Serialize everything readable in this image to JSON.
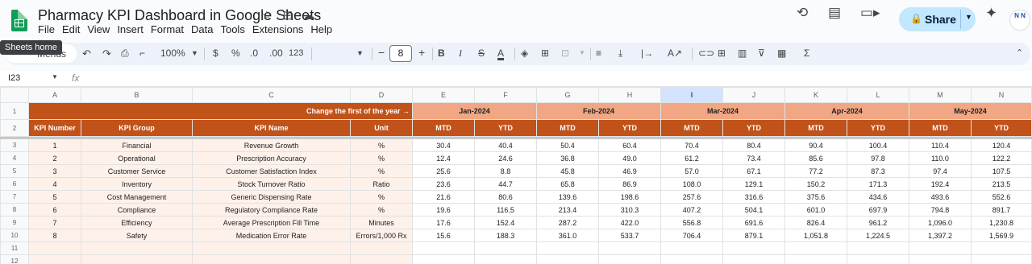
{
  "doc": {
    "title": "Pharmacy KPI Dashboard in Google Sheets"
  },
  "menu": [
    "File",
    "Edit",
    "View",
    "Insert",
    "Format",
    "Data",
    "Tools",
    "Extensions",
    "Help"
  ],
  "tooltip": "Sheets home",
  "share": {
    "label": "Share"
  },
  "avatar": {
    "text": "N N"
  },
  "toolbar": {
    "menus_label": "Menus",
    "zoom": "100%",
    "currency": "$",
    "percent": "%",
    "dec_decrease": ".0",
    "dec_increase": ".00",
    "number_format": "123",
    "font_size": "8",
    "bold": "B",
    "italic": "I",
    "text_color": "A",
    "sigma": "Σ"
  },
  "namebox": {
    "cell": "I23"
  },
  "formula": {
    "fx": "fx"
  },
  "columns": [
    "A",
    "B",
    "C",
    "D",
    "E",
    "F",
    "G",
    "H",
    "I",
    "J",
    "K",
    "L",
    "M",
    "N"
  ],
  "selected_column": "I",
  "rows": [
    "1",
    "2",
    "3",
    "4",
    "5",
    "6",
    "7",
    "8",
    "9",
    "10",
    "11",
    "12"
  ],
  "sheet": {
    "change_label": "Change the first of the year →",
    "months": [
      "Jan-2024",
      "Feb-2024",
      "Mar-2024",
      "Apr-2024",
      "May-2024"
    ],
    "headers": {
      "kpi_number": "KPI Number",
      "kpi_group": "KPI Group",
      "kpi_name": "KPI Name",
      "unit": "Unit",
      "mtd": "MTD",
      "ytd": "YTD"
    },
    "data": [
      {
        "num": "1",
        "group": "Financial",
        "name": "Revenue Growth",
        "unit": "%",
        "vals": [
          "30.4",
          "40.4",
          "50.4",
          "60.4",
          "70.4",
          "80.4",
          "90.4",
          "100.4",
          "110.4",
          "120.4"
        ]
      },
      {
        "num": "2",
        "group": "Operational",
        "name": "Prescription Accuracy",
        "unit": "%",
        "vals": [
          "12.4",
          "24.6",
          "36.8",
          "49.0",
          "61.2",
          "73.4",
          "85.6",
          "97.8",
          "110.0",
          "122.2"
        ]
      },
      {
        "num": "3",
        "group": "Customer Service",
        "name": "Customer Satisfaction Index",
        "unit": "%",
        "vals": [
          "25.6",
          "8.8",
          "45.8",
          "46.9",
          "57.0",
          "67.1",
          "77.2",
          "87.3",
          "97.4",
          "107.5"
        ]
      },
      {
        "num": "4",
        "group": "Inventory",
        "name": "Stock Turnover Ratio",
        "unit": "Ratio",
        "vals": [
          "23.6",
          "44.7",
          "65.8",
          "86.9",
          "108.0",
          "129.1",
          "150.2",
          "171.3",
          "192.4",
          "213.5"
        ]
      },
      {
        "num": "5",
        "group": "Cost Management",
        "name": "Generic Dispensing Rate",
        "unit": "%",
        "vals": [
          "21.6",
          "80.6",
          "139.6",
          "198.6",
          "257.6",
          "316.6",
          "375.6",
          "434.6",
          "493.6",
          "552.6"
        ]
      },
      {
        "num": "6",
        "group": "Compliance",
        "name": "Regulatory Compliance Rate",
        "unit": "%",
        "vals": [
          "19.6",
          "116.5",
          "213.4",
          "310.3",
          "407.2",
          "504.1",
          "601.0",
          "697.9",
          "794.8",
          "891.7"
        ]
      },
      {
        "num": "7",
        "group": "Efficiency",
        "name": "Average Prescription Fill Time",
        "unit": "Minutes",
        "vals": [
          "17.6",
          "152.4",
          "287.2",
          "422.0",
          "556.8",
          "691.6",
          "826.4",
          "961.2",
          "1,096.0",
          "1,230.8"
        ]
      },
      {
        "num": "8",
        "group": "Safety",
        "name": "Medication Error Rate",
        "unit": "Errors/1,000 Rx",
        "vals": [
          "15.6",
          "188.3",
          "361.0",
          "533.7",
          "706.4",
          "879.1",
          "1,051.8",
          "1,224.5",
          "1,397.2",
          "1,569.9"
        ]
      }
    ]
  },
  "colors": {
    "header_dark": "#c0521a",
    "header_month": "#f1a784",
    "peach_fill": "#fdf1ea",
    "share_bg": "#c2e7ff",
    "selected_col": "#d3e3fd"
  }
}
